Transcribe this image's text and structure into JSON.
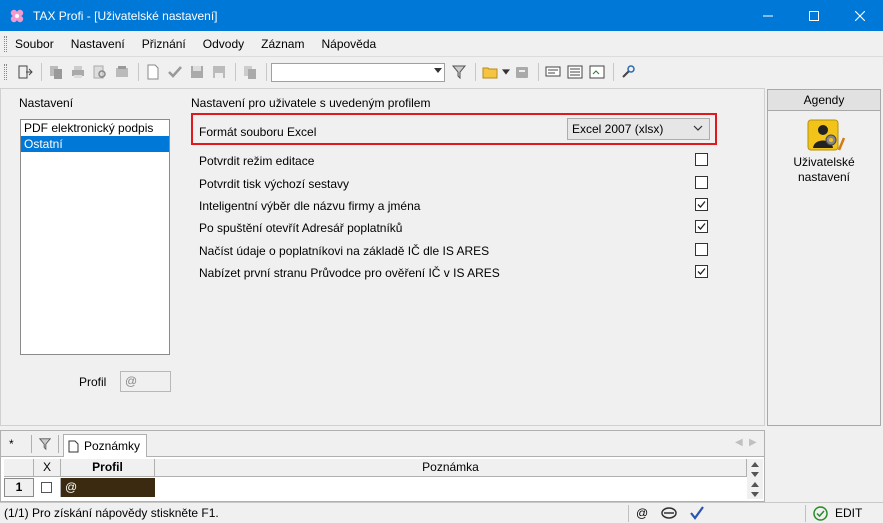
{
  "window": {
    "title": "TAX Profi - [Uživatelské nastavení]",
    "controls": [
      "minimize",
      "maximize",
      "close"
    ]
  },
  "menu": [
    {
      "label": "Soubor"
    },
    {
      "label": "Nastavení"
    },
    {
      "label": "Přiznání"
    },
    {
      "label": "Odvody"
    },
    {
      "label": "Záznam"
    },
    {
      "label": "Nápověda"
    }
  ],
  "toolbar": {
    "search_value": ""
  },
  "left_panel": {
    "title": "Nastavení",
    "items": [
      {
        "label": "PDF elektronický podpis",
        "selected": false
      },
      {
        "label": "Ostatní",
        "selected": true
      }
    ],
    "profile_label": "Profil",
    "profile_value": "@"
  },
  "settings": {
    "title": "Nastavení pro uživatele s uvedeným profilem",
    "file_format": {
      "label": "Formát souboru Excel",
      "value": "Excel 2007 (xlsx)"
    },
    "options": [
      {
        "label": "Potvrdit režim editace",
        "checked": false
      },
      {
        "label": "Potvrdit tisk výchozí sestavy",
        "checked": false
      },
      {
        "label": "Inteligentní výběr dle názvu firmy a jména",
        "checked": true
      },
      {
        "label": "Po spuštění otevřít Adresář poplatníků",
        "checked": true
      },
      {
        "label": "Načíst údaje o poplatníkovi na základě IČ dle IS ARES",
        "checked": false
      },
      {
        "label": "Nabízet první stranu Průvodce pro ověření IČ v IS ARES",
        "checked": true
      }
    ]
  },
  "agendy": {
    "header": "Agendy",
    "items": [
      {
        "label": "Uživatelské nastavení"
      }
    ]
  },
  "bottom_grid": {
    "tab_star": "*",
    "tab_label": "Poznámky",
    "columns": [
      "X",
      "Profil",
      "Poznámka"
    ],
    "rows": [
      {
        "num": "1",
        "checked": false,
        "profil": "@",
        "poznamka": ""
      }
    ]
  },
  "status": {
    "text": "(1/1)  Pro získání nápovědy stiskněte F1.",
    "at_symbol": "@",
    "mode": "EDIT"
  },
  "colors": {
    "titlebar": "#0078d7",
    "selection": "#0078d7",
    "highlight_border": "#e0191e",
    "profile_cell": "#3b2a0f"
  }
}
